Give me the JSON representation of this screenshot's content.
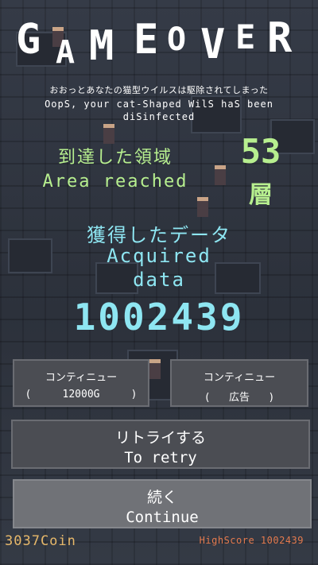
{
  "title": {
    "letters": [
      "G",
      "A",
      "M",
      "E",
      "O",
      "V",
      "E",
      "R"
    ]
  },
  "message": {
    "ja": "おおっとあなたの猫型ウイルスは駆除されてしまった",
    "en_line1": "OopS, your cat-Shaped WilS haS been",
    "en_line2": "diSinfected"
  },
  "area": {
    "label_ja": "到達した領域",
    "label_en": "Area reached",
    "value": "53",
    "unit": "層"
  },
  "data": {
    "label_ja": "獲得したデータ",
    "label_en_line1": "Acquired",
    "label_en_line2": "data",
    "score": "1002439"
  },
  "buttons": {
    "continue_coin": {
      "line1": "コンティニュー",
      "line2": "(     12000G     )"
    },
    "continue_ad": {
      "line1": "コンティニュー",
      "line2": "(   広告   )"
    },
    "retry": {
      "line1": "リトライする",
      "line2": "To retry"
    },
    "continue": {
      "line1": "続く",
      "line2": "Continue"
    }
  },
  "footer": {
    "coins": "3037Coin",
    "highscore": "HighScore 1002439"
  },
  "colors": {
    "green_text": "#b7ef8f",
    "cyan_text": "#8ee6f2",
    "coin_text": "#e7b86a",
    "highscore_text": "#e47a4e"
  }
}
